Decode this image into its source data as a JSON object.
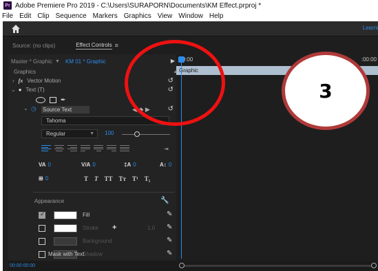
{
  "window": {
    "app_icon": "Pr",
    "title": "Adobe Premiere Pro 2019 - C:\\Users\\SURAPORN\\Documents\\KM Effect.prproj *"
  },
  "menu": [
    "File",
    "Edit",
    "Clip",
    "Sequence",
    "Markers",
    "Graphics",
    "View",
    "Window",
    "Help"
  ],
  "header": {
    "home_icon": "home-icon",
    "learn_label": "Learni"
  },
  "panel_tabs": {
    "source": "Source: (no clips)",
    "effect_controls": "Effect Controls",
    "menu_glyph": "≡"
  },
  "effect_controls": {
    "master_label": "Master * Graphic",
    "clip_label": "KM 01 * Graphic",
    "graphics_label": "Graphics",
    "vector_motion": "Vector Motion",
    "fx_glyph": "fx",
    "text_layer": "Text (T)",
    "source_text": "Source Text",
    "font": "Tahoma",
    "font_style": "Regular",
    "font_size": "100",
    "tracking": "0",
    "kerning": "0",
    "leading": "0",
    "baseline_shift": "0",
    "tsume": "0",
    "style_buttons": [
      "T",
      "T",
      "TT",
      "Tт",
      "T¹",
      "T₁"
    ],
    "appearance_label": "Appearance",
    "appearance": [
      {
        "label": "Fill",
        "checked": true,
        "swatch": "#ffffff",
        "enabled": true
      },
      {
        "label": "Stroke",
        "checked": false,
        "swatch": "#ffffff",
        "enabled": false,
        "value": "1.0"
      },
      {
        "label": "Background",
        "checked": false,
        "swatch": "#3a3a3a",
        "enabled": false
      },
      {
        "label": "Shadow",
        "checked": false,
        "swatch": "#3a3a3a",
        "enabled": false
      }
    ],
    "mask_with_text": "Mask with Text",
    "bottom_timecode": "00:00:00:00"
  },
  "timeline": {
    "start_tc": ":00:00",
    "end_tc": ":00:00",
    "clip_label": "Graphic",
    "playhead_color": "#2d8ceb"
  },
  "annotation": {
    "step_number": "3",
    "ring_color": "#ee1111"
  },
  "colors": {
    "accent": "#2d8ceb",
    "panel_bg": "#232323",
    "clip_bar": "#aebfd0"
  }
}
